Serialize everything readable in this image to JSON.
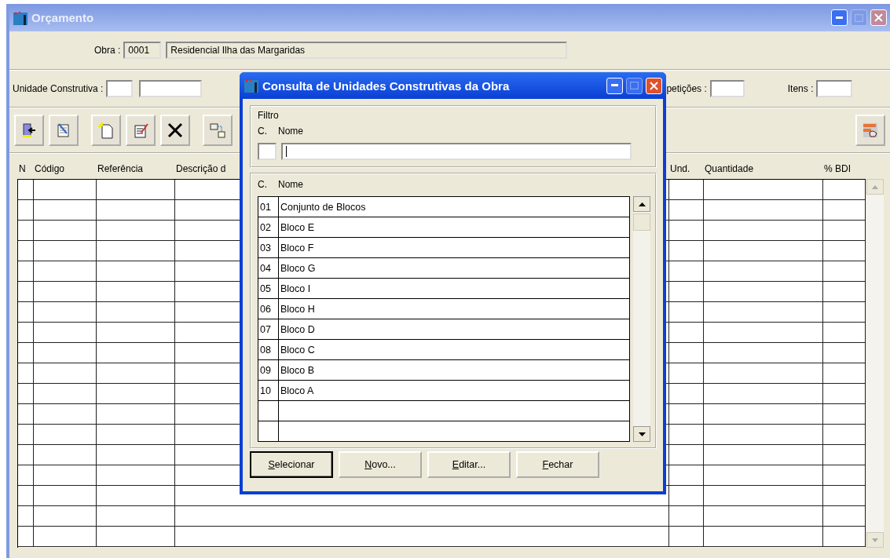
{
  "window": {
    "title": "Orçamento"
  },
  "obra": {
    "label": "Obra :",
    "code": "0001",
    "name": "Residencial Ilha das Margaridas"
  },
  "filters": {
    "unit_label": "Unidade Construtiva :",
    "repeat_label": "petições :",
    "items_label": "Itens :"
  },
  "grid": {
    "columns": [
      "N",
      "Código",
      "Referência",
      "Descrição d",
      "Und.",
      "Quantidade",
      "% BDI"
    ]
  },
  "dialog": {
    "title": "Consulta de Unidades Construtivas da Obra",
    "filter": {
      "legend": "Filtro",
      "code_label": "C.",
      "name_label": "Nome"
    },
    "list": {
      "columns": [
        "C.",
        "Nome"
      ],
      "rows": [
        {
          "code": "01",
          "name": "Conjunto de Blocos"
        },
        {
          "code": "02",
          "name": "Bloco E"
        },
        {
          "code": "03",
          "name": "Bloco F"
        },
        {
          "code": "04",
          "name": "Bloco G"
        },
        {
          "code": "05",
          "name": "Bloco I"
        },
        {
          "code": "06",
          "name": "Bloco H"
        },
        {
          "code": "07",
          "name": "Bloco D"
        },
        {
          "code": "08",
          "name": "Bloco C"
        },
        {
          "code": "09",
          "name": "Bloco B"
        },
        {
          "code": "10",
          "name": "Bloco A"
        }
      ]
    },
    "buttons": [
      {
        "label": "Selecionar",
        "default": true
      },
      {
        "label": "Novo...",
        "default": false
      },
      {
        "label": "Editar...",
        "default": false
      },
      {
        "label": "Fechar",
        "default": false
      }
    ]
  }
}
